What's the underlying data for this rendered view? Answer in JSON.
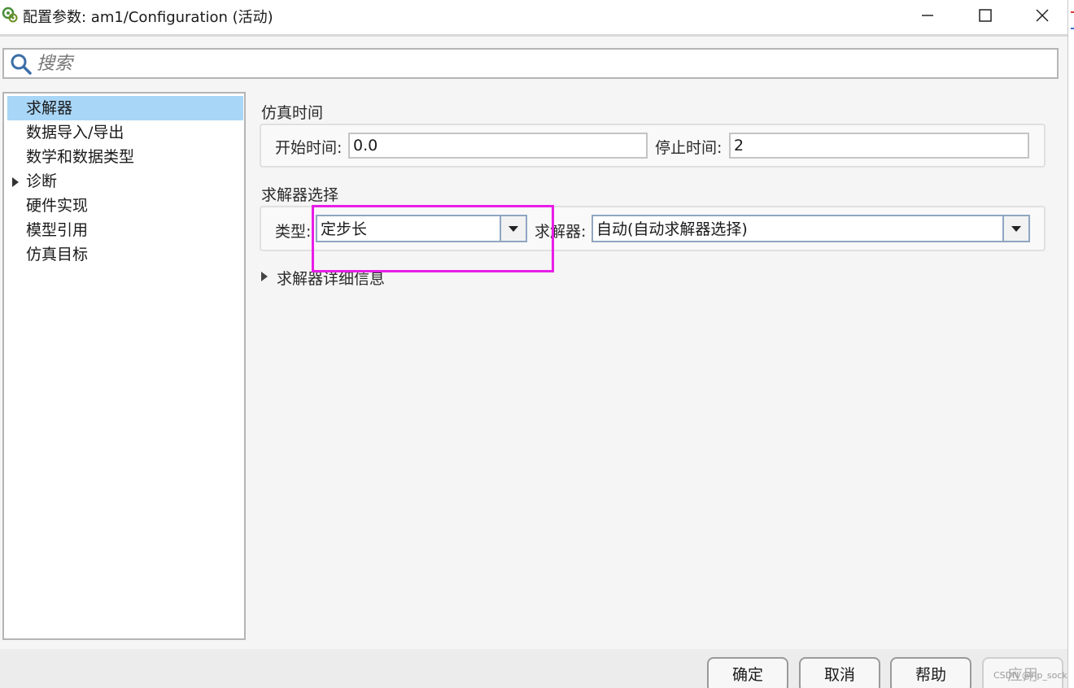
{
  "window": {
    "title": "配置参数: am1/Configuration (活动)",
    "controls": {
      "minimize": "minimize",
      "maximize": "maximize",
      "close": "close"
    }
  },
  "search": {
    "placeholder": "搜索"
  },
  "tree": {
    "items": [
      {
        "label": "求解器",
        "selected": true,
        "expandable": false
      },
      {
        "label": "数据导入/导出",
        "selected": false,
        "expandable": false
      },
      {
        "label": "数学和数据类型",
        "selected": false,
        "expandable": false
      },
      {
        "label": "诊断",
        "selected": false,
        "expandable": true
      },
      {
        "label": "硬件实现",
        "selected": false,
        "expandable": false
      },
      {
        "label": "模型引用",
        "selected": false,
        "expandable": false
      },
      {
        "label": "仿真目标",
        "selected": false,
        "expandable": false
      }
    ]
  },
  "sim_time": {
    "heading": "仿真时间",
    "start_label": "开始时间:",
    "start_value": "0.0",
    "stop_label": "停止时间:",
    "stop_value": "2"
  },
  "solver_select": {
    "heading": "求解器选择",
    "type_label": "类型:",
    "type_value": "定步长",
    "solver_label": "求解器:",
    "solver_value": "自动(自动求解器选择)"
  },
  "solver_details": {
    "label": "求解器详细信息",
    "expanded": false
  },
  "buttons": {
    "ok": "确定",
    "cancel": "取消",
    "help": "帮助",
    "apply": "应用"
  },
  "watermark": "CSDN @rip_sock",
  "colors": {
    "selection": "#a8d6f7",
    "highlight_box": "#e81ee8",
    "icon_green": "#4a8f3a"
  }
}
